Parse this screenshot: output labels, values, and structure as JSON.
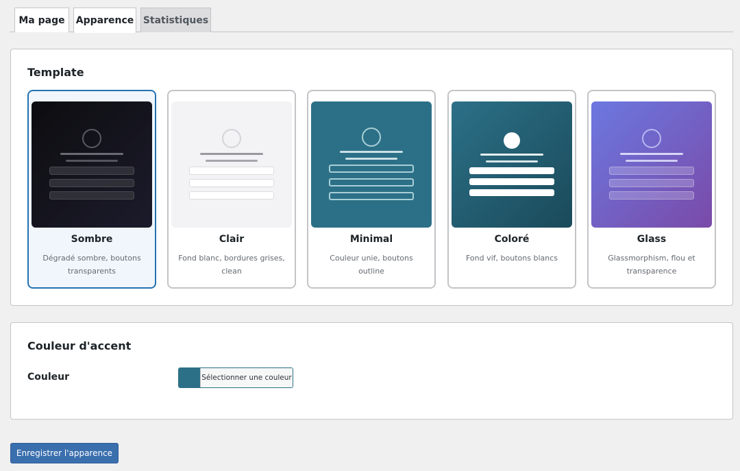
{
  "tabs": [
    {
      "label": "Ma page"
    },
    {
      "label": "Apparence"
    },
    {
      "label": "Statistiques"
    }
  ],
  "template_section": {
    "title": "Template",
    "selected": "Sombre",
    "templates": [
      {
        "name": "Sombre",
        "description": "Dégradé sombre, boutons transparents"
      },
      {
        "name": "Clair",
        "description": "Fond blanc, bordures grises, clean"
      },
      {
        "name": "Minimal",
        "description": "Couleur unie, boutons outline"
      },
      {
        "name": "Coloré",
        "description": "Fond vif, boutons blancs"
      },
      {
        "name": "Glass",
        "description": "Glassmorphism, flou et transparence"
      }
    ]
  },
  "accent_section": {
    "title": "Couleur d'accent",
    "color_label": "Couleur",
    "picker_label": "Sélectionner une couleur",
    "current_color": "#2c7087"
  },
  "save_button": "Enregistrer l'apparence",
  "colors": {
    "accent": "#2271b1",
    "primary_button": "#3a6fae"
  }
}
